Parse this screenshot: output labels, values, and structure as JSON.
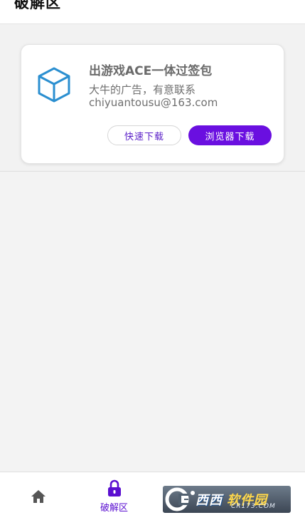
{
  "header": {
    "title": "破解区"
  },
  "card": {
    "icon": "cube-icon",
    "title": "出游戏ACE一体过签包",
    "description": "大牛的广告，有意联系",
    "email": "chiyuantousu@163.com",
    "quick_download_label": "快速下载",
    "browser_download_label": "浏览器下载"
  },
  "bottom_nav": {
    "items": [
      {
        "icon": "home-icon",
        "label": ""
      },
      {
        "icon": "lock-icon",
        "label": "破解区",
        "active": true
      }
    ]
  },
  "watermark": {
    "text_primary": "西西",
    "text_secondary": "软件园",
    "text_sub": "CR173.COM"
  },
  "colors": {
    "accent": "#6a0fe0",
    "icon_blue": "#2b8fd0",
    "text_gray": "#6f6f6f"
  }
}
